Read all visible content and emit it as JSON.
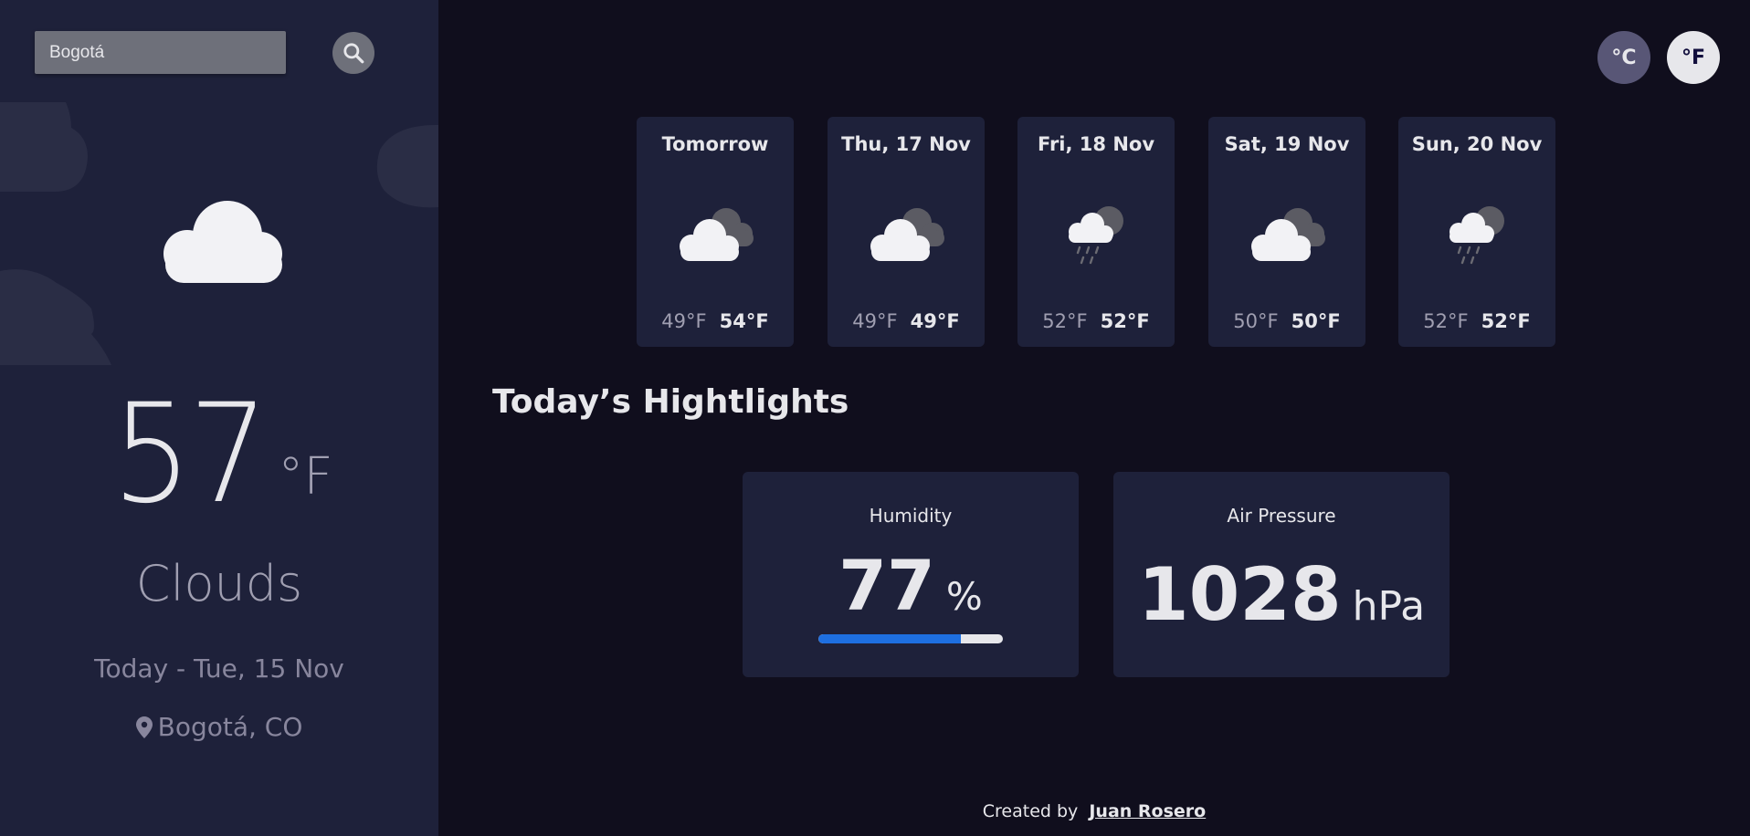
{
  "sidebar": {
    "search": {
      "value": "Bogotá"
    },
    "current": {
      "temp": "57",
      "unit": "°F",
      "condition": "Clouds",
      "icon": "cloud-icon",
      "date": "Today - Tue, 15 Nov",
      "location": "Bogotá, CO"
    }
  },
  "units": {
    "celsius": "°C",
    "fahrenheit": "°F",
    "active": "fahrenheit"
  },
  "forecast": [
    {
      "day": "Tomorrow",
      "min": "49°F",
      "max": "54°F",
      "icon": "broken-clouds-icon"
    },
    {
      "day": "Thu, 17 Nov",
      "min": "49°F",
      "max": "49°F",
      "icon": "broken-clouds-icon"
    },
    {
      "day": "Fri, 18 Nov",
      "min": "52°F",
      "max": "52°F",
      "icon": "rain-icon"
    },
    {
      "day": "Sat, 19 Nov",
      "min": "50°F",
      "max": "50°F",
      "icon": "broken-clouds-icon"
    },
    {
      "day": "Sun, 20 Nov",
      "min": "52°F",
      "max": "52°F",
      "icon": "rain-icon"
    }
  ],
  "highlights": {
    "title": "Today’s Hightlights",
    "humidity": {
      "label": "Humidity",
      "value": "77",
      "unit": "%",
      "percent": 77
    },
    "pressure": {
      "label": "Air Pressure",
      "value": "1028",
      "unit": "hPa"
    }
  },
  "footer": {
    "prefix": "Created by",
    "author": "Juan Rosero"
  },
  "colors": {
    "sidebar_bg": "#1e213a",
    "main_bg": "#100e1d",
    "card_bg": "#1e213a",
    "progress_fill": "#1e6fe0",
    "unit_active_bg": "#e7e7eb",
    "unit_inactive_bg": "#585676"
  }
}
